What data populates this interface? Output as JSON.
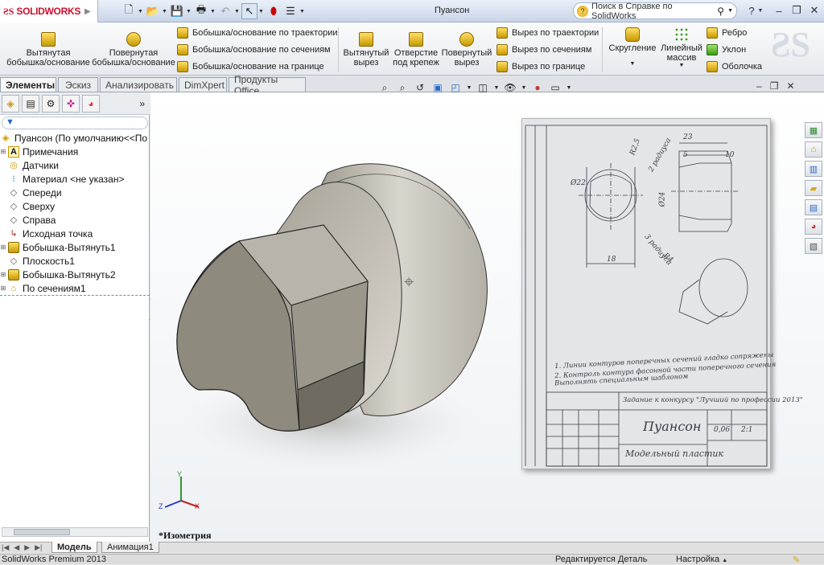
{
  "app": {
    "brand": "SOLIDWORKS",
    "document_title": "Пуансон",
    "help_search_placeholder": "Поиск в Справке по SolidWorks"
  },
  "command_manager": {
    "features_left": [
      {
        "label": "Вытянутая бобышка/основание"
      },
      {
        "label": "Повернутая бобышка/основание"
      }
    ],
    "features_small_1": [
      {
        "label": "Бобышка/основание по траектории"
      },
      {
        "label": "Бобышка/основание по сечениям"
      },
      {
        "label": "Бобышка/основание на границе"
      }
    ],
    "features_mid": [
      {
        "label": "Вытянутый вырез"
      },
      {
        "label": "Отверстие под крепеж"
      },
      {
        "label": "Повернутый вырез"
      }
    ],
    "features_small_2": [
      {
        "label": "Вырез по траектории"
      },
      {
        "label": "Вырез по сечениям"
      },
      {
        "label": "Вырез по границе"
      }
    ],
    "features_right": [
      {
        "label": "Скругление"
      },
      {
        "label": "Линейный массив"
      }
    ],
    "features_small_3": [
      {
        "label": "Ребро"
      },
      {
        "label": "Уклон"
      },
      {
        "label": "Оболочка"
      }
    ]
  },
  "tabs": [
    {
      "label": "Элементы",
      "active": true
    },
    {
      "label": "Эскиз"
    },
    {
      "label": "Анализировать"
    },
    {
      "label": "DimXpert"
    },
    {
      "label": "Продукты Office"
    }
  ],
  "tree": {
    "root": "Пуансон  (По умолчанию<<По",
    "items": [
      {
        "label": "Примечания",
        "icon": "annotations-icon"
      },
      {
        "label": "Датчики",
        "icon": "sensors-icon"
      },
      {
        "label": "Материал <не указан>",
        "icon": "material-icon"
      },
      {
        "label": "Спереди",
        "icon": "plane-icon"
      },
      {
        "label": "Сверху",
        "icon": "plane-icon"
      },
      {
        "label": "Справа",
        "icon": "plane-icon"
      },
      {
        "label": "Исходная точка",
        "icon": "origin-icon"
      },
      {
        "label": "Бобышка-Вытянуть1",
        "icon": "extrude-icon"
      },
      {
        "label": "Плоскость1",
        "icon": "plane-icon"
      },
      {
        "label": "Бобышка-Вытянуть2",
        "icon": "extrude-icon"
      },
      {
        "label": "По сечениям1",
        "icon": "loft-icon"
      }
    ]
  },
  "viewport": {
    "view_label": "*Изометрия",
    "axes": {
      "x": "X",
      "y": "Y",
      "z": "Z"
    }
  },
  "drawing": {
    "title": "Пуансон",
    "subtitle": "Модельный пластик",
    "contest": "Задание к конкурсу \"Лучший по профессии 2013\"",
    "scale": "0,06",
    "sheet": "2:1",
    "notes": [
      "1. Линии контуров поперечных сечений гладко сопряжены",
      "2. Контроль контура фасонной части поперечного сечения",
      "Выполнять специальным шаблоном"
    ],
    "dims": [
      "23",
      "10",
      "5",
      "R2,5",
      "2 радиуса",
      "Ø22",
      "Ø24",
      "18",
      "3 радиуса",
      "R4"
    ]
  },
  "bottom_tabs": [
    {
      "label": "Модель",
      "active": true
    },
    {
      "label": "Анимация1"
    }
  ],
  "status": {
    "product": "SolidWorks Premium 2013",
    "editing": "Редактируется Деталь",
    "settings": "Настройка"
  }
}
